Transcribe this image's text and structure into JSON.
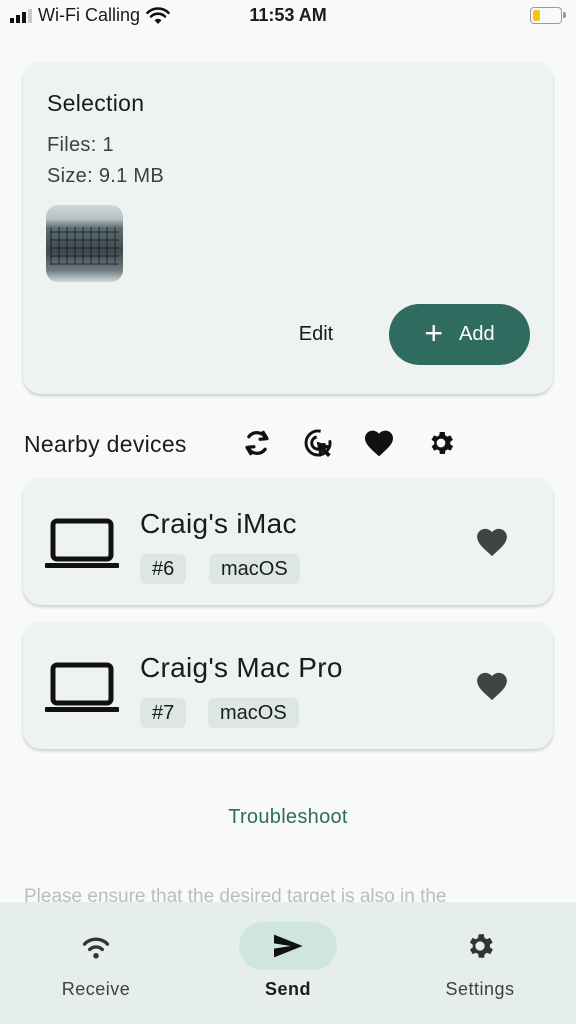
{
  "status_bar": {
    "carrier": "Wi-Fi Calling",
    "time": "11:53 AM",
    "battery_percent": 25
  },
  "selection": {
    "title": "Selection",
    "files": "Files: 1",
    "size": "Size: 9.1 MB",
    "thumbnail_icon": "keyboard-photo",
    "edit_label": "Edit",
    "add_label": "Add"
  },
  "nearby": {
    "title": "Nearby devices",
    "icons": [
      "refresh-icon",
      "cursor-click-icon",
      "heart-icon",
      "gear-icon"
    ]
  },
  "devices": [
    {
      "name": "Craig's iMac",
      "id": "#6",
      "os": "macOS",
      "icon": "laptop-icon",
      "favorite_icon": "heart-icon"
    },
    {
      "name": "Craig's Mac Pro",
      "id": "#7",
      "os": "macOS",
      "icon": "laptop-icon",
      "favorite_icon": "heart-icon"
    }
  ],
  "troubleshoot_label": "Troubleshoot",
  "hint_text": "Please ensure that the desired target is also in the",
  "nav": {
    "items": [
      {
        "label": "Receive",
        "icon": "wifi-icon",
        "active": false
      },
      {
        "label": "Send",
        "icon": "send-icon",
        "active": true
      },
      {
        "label": "Settings",
        "icon": "gear-icon",
        "active": false
      }
    ]
  },
  "colors": {
    "accent": "#2f6b5f",
    "card_bg": "#eef2f0",
    "chip_bg": "#dce7e3",
    "nav_bg": "#e6eeeb",
    "nav_active_pill": "#cfe6dd"
  }
}
